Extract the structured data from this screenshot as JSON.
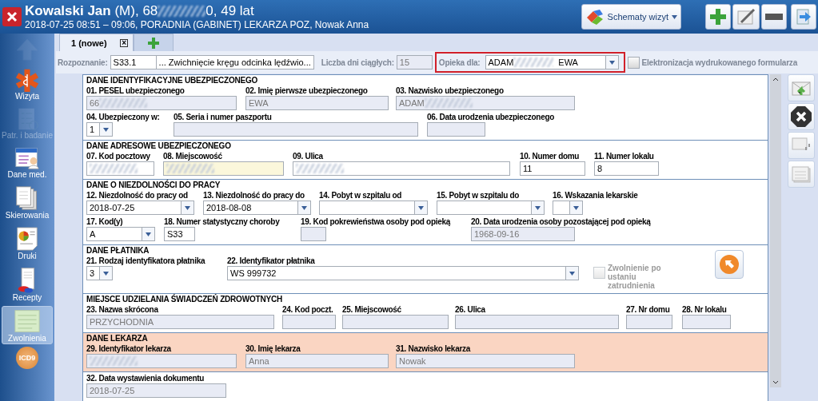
{
  "header": {
    "name": "Kowalski Jan",
    "details_before": "(M), 68",
    "details_after": "0, 49 lat",
    "visit": "2018-07-25 08:51 – 09:06, PORADNIA (GABINET) LEKARZA POZ, Nowak Anna",
    "schedule_button": "Schematy wizyt"
  },
  "sidebar": {
    "items": [
      {
        "kind": "arrow",
        "disabled": true,
        "selected": false
      },
      {
        "kind": "visit",
        "label": "Wizyta",
        "disabled": false,
        "selected": false
      },
      {
        "kind": "exam",
        "label": "Patr. i badanie",
        "disabled": true,
        "selected": false
      },
      {
        "kind": "medical",
        "label": "Dane med.",
        "disabled": false,
        "selected": false
      },
      {
        "kind": "referral",
        "label": "Skierowania",
        "disabled": false,
        "selected": false
      },
      {
        "kind": "print",
        "label": "Druki",
        "disabled": false,
        "selected": false
      },
      {
        "kind": "prescription",
        "label": "Recepty",
        "disabled": false,
        "selected": false
      },
      {
        "kind": "leave",
        "label": "Zwolnienia",
        "disabled": false,
        "selected": true
      },
      {
        "kind": "badge",
        "label": "ICD9",
        "disabled": false,
        "selected": false
      }
    ]
  },
  "tabs": [
    {
      "label": "1 (nowe)",
      "close": "×",
      "selected": true
    }
  ],
  "toolbar": {
    "diagnosis_label": "Rozpoznanie:",
    "diagnosis_code": "S33.1",
    "browse": "...",
    "diagnosis_name": "Zwichnięcie kręgu odcinka lędźwio...",
    "days_label": "Liczba dni ciągłych:",
    "days": "15",
    "care_label": "Opieka dla:",
    "care_first": "ADAM",
    "care_second": "EWA",
    "electronic_label": "Elektronizacja wydrukowanego formularza",
    "electronic_checked": false
  },
  "sections": [
    {
      "title": "DANE IDENTYFIKACYJNE UBEZPIECZONEGO",
      "highlighted": false,
      "rows": [
        [
          {
            "label": "01. PESEL ubezpieczonego",
            "value": "66",
            "kind": "readonly",
            "redacted": true
          },
          {
            "label": "02. Imię pierwsze ubezpieczonego",
            "value": "EWA",
            "kind": "readonly",
            "redacted": false
          },
          {
            "label": "03. Nazwisko ubezpieczonego",
            "value": "ADAM",
            "kind": "readonly",
            "redacted": true
          }
        ],
        [
          {
            "label": "04. Ubezpieczony w:",
            "value": "1",
            "kind": "combo",
            "redacted": false
          },
          {
            "label": "05. Seria i numer paszportu",
            "kind": "readonly",
            "redacted": false
          },
          {
            "label": "06. Data urodzenia ubezpieczonego",
            "kind": "readonly",
            "redacted": false
          }
        ]
      ]
    },
    {
      "title": "DANE ADRESOWE UBEZPIECZONEGO",
      "highlighted": false,
      "rows": [
        [
          {
            "label": "07. Kod pocztowy",
            "kind": "input",
            "redacted": true
          },
          {
            "label": "08. Miejscowość",
            "kind": "required",
            "redacted": true
          },
          {
            "label": "09. Ulica",
            "kind": "input",
            "redacted": true
          },
          {
            "label": "10. Numer domu",
            "value": "11",
            "kind": "input",
            "redacted": false
          },
          {
            "label": "11. Numer lokalu",
            "value": "8",
            "kind": "input",
            "redacted": false
          }
        ]
      ]
    },
    {
      "title": "DANE O NIEZDOLNOŚCI DO PRACY",
      "highlighted": false,
      "rows": [
        [
          {
            "label": "12. Niezdolność do pracy od",
            "value": "2018-07-25",
            "kind": "combo",
            "redacted": false
          },
          {
            "label": "13. Niezdolność do pracy do",
            "value": "2018-08-08",
            "kind": "combo",
            "redacted": false
          },
          {
            "label": "14. Pobyt w szpitalu od",
            "kind": "combo",
            "redacted": false
          },
          {
            "label": "15. Pobyt w szpitalu do",
            "kind": "combo",
            "redacted": false
          },
          {
            "label": "16. Wskazania lekarskie",
            "kind": "combo",
            "redacted": false
          }
        ],
        [
          {
            "label": "17. Kod(y)",
            "value": "A",
            "kind": "combo",
            "redacted": false
          },
          {
            "label": "18. Numer statystyczny choroby",
            "value": "S33",
            "kind": "input",
            "redacted": false
          },
          {
            "label": "19. Kod pokrewieństwa osoby pod opieką",
            "kind": "readonly",
            "redacted": false
          },
          {
            "label": "20. Data urodzenia osoby pozostającej pod opieką",
            "value": "1968-09-16",
            "kind": "readonly",
            "redacted": false
          }
        ]
      ]
    },
    {
      "title": "DANE PŁATNIKA",
      "highlighted": false,
      "rows": [
        [
          {
            "label": "21. Rodzaj identyfikatora płatnika",
            "value": "3",
            "kind": "combo",
            "redacted": false
          },
          {
            "label": "22. Identyfikator płatnika",
            "value": "WS 999732",
            "kind": "combo",
            "redacted": false
          }
        ]
      ],
      "checkbox": {
        "label": "Zwolnienie po ustaniu zatrudnienia",
        "checked": false,
        "disabled": true
      }
    },
    {
      "title": "MIEJSCE UDZIELANIA ŚWIADCZEŃ ZDROWOTNYCH",
      "highlighted": false,
      "rows": [
        [
          {
            "label": "23. Nazwa skrócona",
            "value": "PRZYCHODNIA",
            "kind": "readonly",
            "redacted": false
          },
          {
            "label": "24. Kod poczt.",
            "kind": "readonly",
            "redacted": false
          },
          {
            "label": "25. Miejscowość",
            "kind": "readonly",
            "redacted": false
          },
          {
            "label": "26. Ulica",
            "kind": "readonly",
            "redacted": false
          },
          {
            "label": "27. Nr domu",
            "kind": "readonly",
            "redacted": false
          },
          {
            "label": "28. Nr lokalu",
            "kind": "readonly",
            "redacted": false
          }
        ]
      ]
    },
    {
      "title": "DANE LEKARZA",
      "highlighted": true,
      "rows": [
        [
          {
            "label": "29. Identyfikator lekarza",
            "kind": "readonly",
            "redacted": true
          },
          {
            "label": "30. Imię lekarza",
            "value": "Anna",
            "kind": "readonly",
            "redacted": false
          },
          {
            "label": "31. Nazwisko lekarza",
            "value": "Nowak",
            "kind": "readonly",
            "redacted": false
          }
        ]
      ]
    },
    {
      "highlighted": false,
      "rows": [
        [
          {
            "label": "32. Data wystawienia dokumentu",
            "value": "2018-07-25",
            "kind": "readonly",
            "redacted": false
          }
        ]
      ]
    }
  ]
}
